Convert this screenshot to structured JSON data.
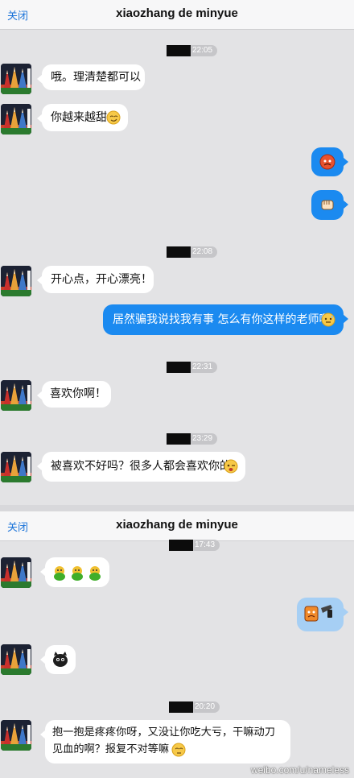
{
  "screens": [
    {
      "nav": {
        "close_label": "关闭",
        "title": "xiaozhang de minyue"
      },
      "messages": {
        "ts1": "22:05",
        "m1": "哦。理清楚都可以",
        "m2": "你越来越甜",
        "ts2": "22:08",
        "m3": "开心点，开心漂亮！",
        "m4": "居然骗我说找我有事 怎么有你这样的老师啊",
        "ts3": "22:31",
        "m5": "喜欢你啊！",
        "ts4": "23:29",
        "m6": "被喜欢不好吗？很多人都会喜欢你的"
      }
    },
    {
      "nav": {
        "close_label": "关闭",
        "title": "xiaozhang de minyue"
      },
      "messages": {
        "ts1": "17:43",
        "ts2": "20:20",
        "m1_line1": "抱一抱是疼疼你呀，又没让你吃大亏，干嘛动刀",
        "m1_line2": "见血的啊？报复不对等嘛"
      }
    }
  ],
  "watermark": "weibo.com/u/nameless",
  "colors": {
    "outgoing": "#1b8af0",
    "incoming": "#ffffff",
    "link": "#1a73d9",
    "background": "#e3e3e5"
  },
  "icons": [
    "pencils-avatar-icon",
    "emoji-angry-icon",
    "emoji-fist-icon",
    "emoji-smirk-icon",
    "emoji-blush-icon",
    "emoji-wink-icon",
    "emoji-sweat-icon",
    "emoji-frog-icon",
    "emoji-knife-icon",
    "emoji-creature-icon"
  ]
}
